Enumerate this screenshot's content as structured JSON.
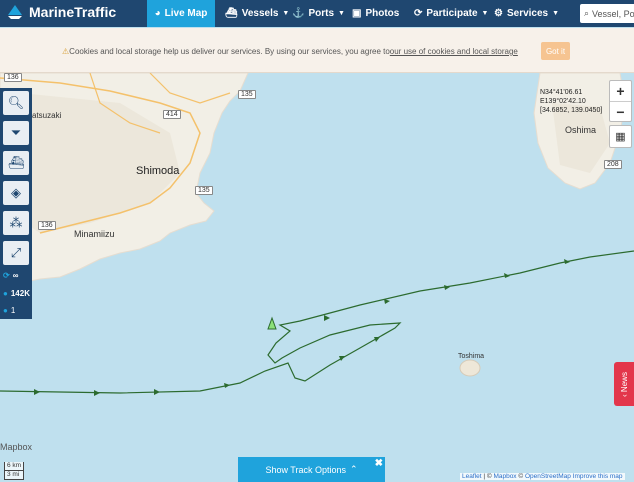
{
  "header": {
    "logo_text": "MarineTraffic",
    "nav": [
      {
        "label": "Live Map",
        "icon": "globe-icon"
      },
      {
        "label": "Vessels",
        "icon": "ship-icon"
      },
      {
        "label": "Ports",
        "icon": "anchor-icon"
      },
      {
        "label": "Photos",
        "icon": "camera-icon"
      },
      {
        "label": "Participate",
        "icon": "refresh-icon"
      },
      {
        "label": "Services",
        "icon": "gear-icon"
      }
    ],
    "search_text": "Vessel, Po"
  },
  "cookie": {
    "text_before": "Cookies and local storage help us deliver our services. By using our services, you agree to",
    "link_text": "our use of cookies and local storage",
    "button_label": "Got it"
  },
  "map": {
    "labels": {
      "matsuzaki": "atsuzaki",
      "shimoda": "Shimoda",
      "minamiizu": "Minamiizu",
      "oshima": "Oshima",
      "toshima": "Toshima",
      "mapbox": "Mapbox"
    },
    "roads": [
      "136",
      "135",
      "414",
      "135",
      "136",
      "208"
    ],
    "coords": [
      "N34°41'06.61",
      "E139°02'42.10",
      "[34.6852, 139.0450]"
    ],
    "scale": [
      "6 km",
      "3 mi"
    ],
    "attribution": {
      "leaflet": "Leaflet",
      "sep1": " | © ",
      "mapbox": "Mapbox",
      "sep2": " © ",
      "osm": "OpenStreetMap",
      "improve": " Improve this map"
    }
  },
  "toolbar": {
    "stats": [
      {
        "label": "∞",
        "icon": "infinity-icon"
      },
      {
        "label": "142K",
        "icon": "info-icon"
      },
      {
        "label": "1",
        "icon": "info-icon"
      }
    ]
  },
  "zoom": {
    "in": "+",
    "out": "−"
  },
  "track_options": {
    "label": "Show Track Options",
    "close": "✖"
  },
  "news_tab": {
    "label": "News"
  },
  "colors": {
    "header_bg": "#1f4770",
    "accent": "#1fa3dc",
    "track": "#2c6b2f",
    "sea": "#bfe0ee",
    "news": "#e3364b"
  }
}
